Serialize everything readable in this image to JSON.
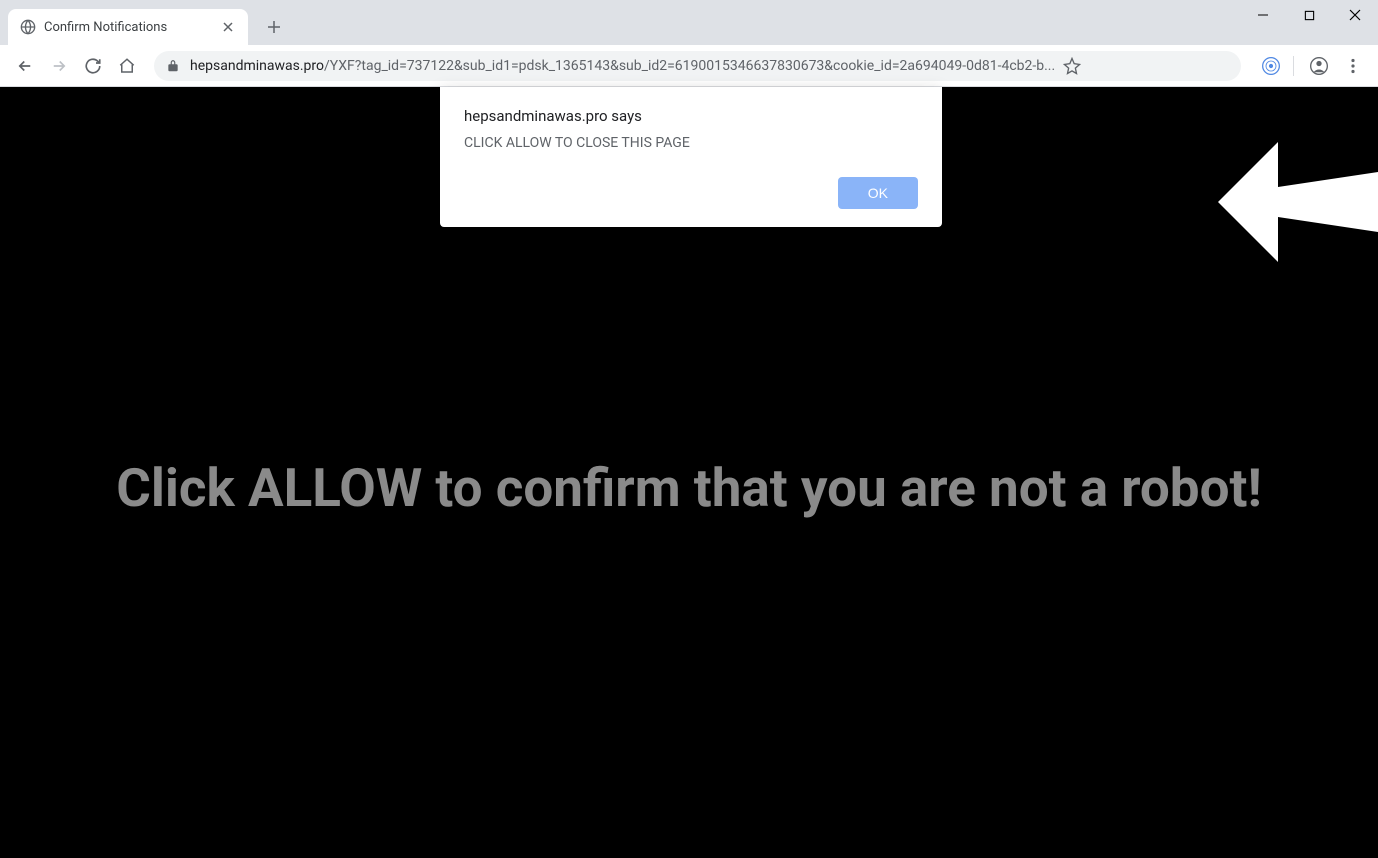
{
  "tab": {
    "title": "Confirm Notifications"
  },
  "url": {
    "domain": "hepsandminawas.pro",
    "path": "/YXF?tag_id=737122&sub_id1=pdsk_1365143&sub_id2=6190015346637830673&cookie_id=2a694049-0d81-4cb2-b..."
  },
  "dialog": {
    "title": "hepsandminawas.pro says",
    "message": "CLICK ALLOW TO CLOSE THIS PAGE",
    "ok_label": "OK"
  },
  "page": {
    "main_text": "Click ALLOW to confirm that you are not a robot!"
  }
}
